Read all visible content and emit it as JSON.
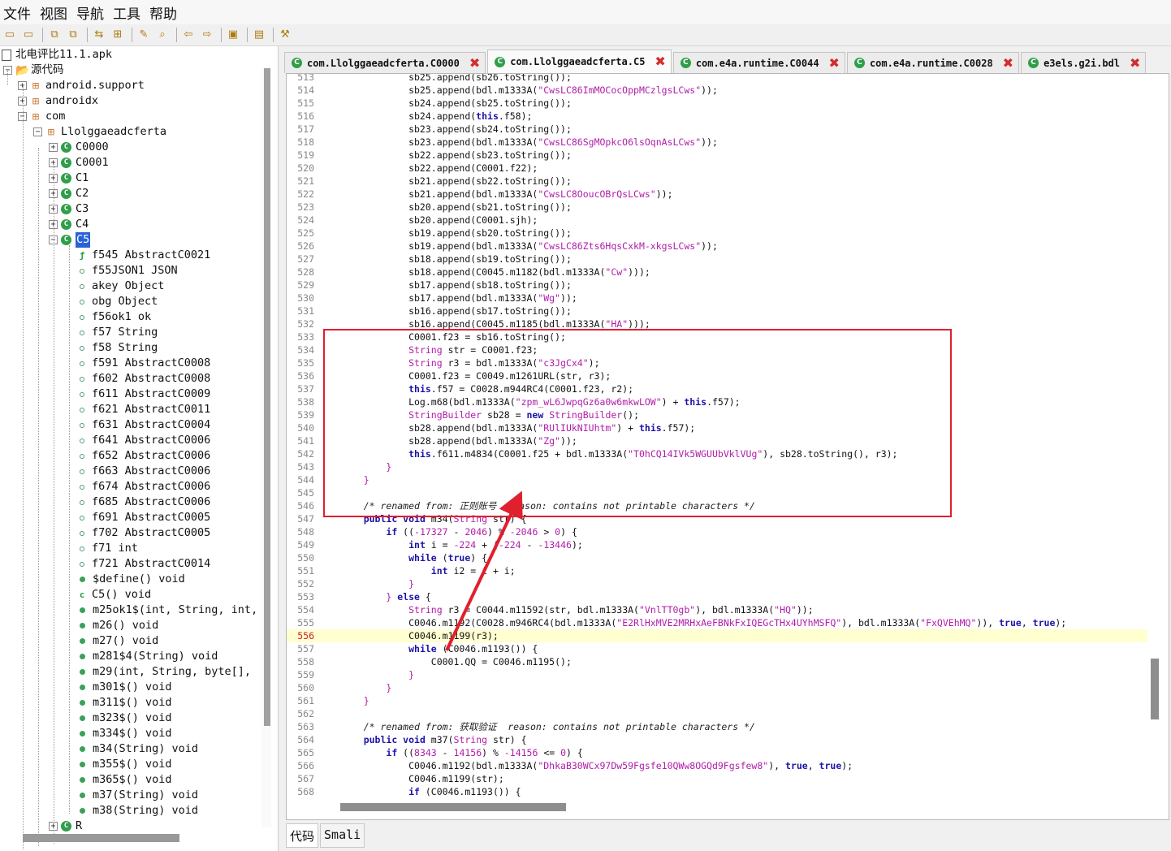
{
  "menu": [
    "文件",
    "视图",
    "导航",
    "工具",
    "帮助"
  ],
  "toolbar_icons": [
    "open-file-icon",
    "add-file-icon",
    "copy-icon",
    "copy-all-icon",
    "sync-icon",
    "tree-icon",
    "wand-icon",
    "search-icon",
    "back-arrow-icon",
    "forward-arrow-icon",
    "decompile-icon",
    "log-icon",
    "preferences-icon"
  ],
  "tree": {
    "root": "北电评比11.1.apk",
    "source": "源代码",
    "packages": [
      "android.support",
      "androidx",
      "com"
    ],
    "subpackage": "Llolggaeadcferta",
    "classes": [
      "C0000",
      "C0001",
      "C1",
      "C2",
      "C3",
      "C4",
      "C5"
    ],
    "selected_class": "C5",
    "members": [
      {
        "kind": "field-static",
        "text": "f545 AbstractC0021"
      },
      {
        "kind": "field",
        "text": "f55JSON1 JSON"
      },
      {
        "kind": "field",
        "text": "akey Object"
      },
      {
        "kind": "field",
        "text": "obg Object"
      },
      {
        "kind": "field",
        "text": "f56ok1 ok"
      },
      {
        "kind": "field",
        "text": "f57 String"
      },
      {
        "kind": "field",
        "text": "f58 String"
      },
      {
        "kind": "field",
        "text": "f591 AbstractC0008"
      },
      {
        "kind": "field",
        "text": "f602 AbstractC0008"
      },
      {
        "kind": "field",
        "text": "f611 AbstractC0009"
      },
      {
        "kind": "field",
        "text": "f621 AbstractC0011"
      },
      {
        "kind": "field",
        "text": "f631 AbstractC0004"
      },
      {
        "kind": "field",
        "text": "f641 AbstractC0006"
      },
      {
        "kind": "field",
        "text": "f652 AbstractC0006"
      },
      {
        "kind": "field",
        "text": "f663 AbstractC0006"
      },
      {
        "kind": "field",
        "text": "f674 AbstractC0006"
      },
      {
        "kind": "field",
        "text": "f685 AbstractC0006"
      },
      {
        "kind": "field",
        "text": "f691 AbstractC0005"
      },
      {
        "kind": "field",
        "text": "f702 AbstractC0005"
      },
      {
        "kind": "field",
        "text": "f71 int"
      },
      {
        "kind": "field",
        "text": "f721 AbstractC0014"
      },
      {
        "kind": "method",
        "text": "$define() void"
      },
      {
        "kind": "ctor",
        "text": "C5() void"
      },
      {
        "kind": "method",
        "text": "m25ok1$(int, String, int,"
      },
      {
        "kind": "method",
        "text": "m26() void"
      },
      {
        "kind": "method",
        "text": "m27() void"
      },
      {
        "kind": "method",
        "text": "m281$4(String) void"
      },
      {
        "kind": "method",
        "text": "m29(int, String, byte[],"
      },
      {
        "kind": "method",
        "text": "m301$() void"
      },
      {
        "kind": "method",
        "text": "m311$() void"
      },
      {
        "kind": "method",
        "text": "m323$() void"
      },
      {
        "kind": "method",
        "text": "m334$() void"
      },
      {
        "kind": "method",
        "text": "m34(String) void"
      },
      {
        "kind": "method",
        "text": "m355$() void"
      },
      {
        "kind": "method",
        "text": "m365$() void"
      },
      {
        "kind": "method",
        "text": "m37(String) void"
      },
      {
        "kind": "method",
        "text": "m38(String) void"
      }
    ],
    "last_row": "R"
  },
  "tabs": [
    {
      "label": "com.Llolggaeadcferta.C0000",
      "active": false
    },
    {
      "label": "com.Llolggaeadcferta.C5",
      "active": true
    },
    {
      "label": "com.e4a.runtime.C0044",
      "active": false
    },
    {
      "label": "com.e4a.runtime.C0028",
      "active": false
    },
    {
      "label": "e3els.g2i.bdl",
      "active": false
    }
  ],
  "current_line": "556",
  "code_lines": [
    {
      "n": "513",
      "html": "            sb25.append(sb26.toString());"
    },
    {
      "n": "514",
      "html": "            sb25.append(bdl.m1333A(<s>\"CwsLC86ImMOCocOppMCzlgsLCws\"</s>));"
    },
    {
      "n": "515",
      "html": "            sb24.append(sb25.toString());"
    },
    {
      "n": "516",
      "html": "            sb24.append(<k>this</k>.f58);"
    },
    {
      "n": "517",
      "html": "            sb23.append(sb24.toString());"
    },
    {
      "n": "518",
      "html": "            sb23.append(bdl.m1333A(<s>\"CwsLC86SgMOpkcO6lsOqnAsLCws\"</s>));"
    },
    {
      "n": "519",
      "html": "            sb22.append(sb23.toString());"
    },
    {
      "n": "520",
      "html": "            sb22.append(C0001.f22);"
    },
    {
      "n": "521",
      "html": "            sb21.append(sb22.toString());"
    },
    {
      "n": "522",
      "html": "            sb21.append(bdl.m1333A(<s>\"CwsLC8OoucOBrQsLCws\"</s>));"
    },
    {
      "n": "523",
      "html": "            sb20.append(sb21.toString());"
    },
    {
      "n": "524",
      "html": "            sb20.append(C0001.sjh);"
    },
    {
      "n": "525",
      "html": "            sb19.append(sb20.toString());"
    },
    {
      "n": "526",
      "html": "            sb19.append(bdl.m1333A(<s>\"CwsLC86Zts6HqsCxkM-xkgsLCws\"</s>));"
    },
    {
      "n": "527",
      "html": "            sb18.append(sb19.toString());"
    },
    {
      "n": "528",
      "html": "            sb18.append(C0045.m1182(bdl.m1333A(<s>\"Cw\"</s>)));"
    },
    {
      "n": "529",
      "html": "            sb17.append(sb18.toString());"
    },
    {
      "n": "530",
      "html": "            sb17.append(bdl.m1333A(<s>\"Wg\"</s>));"
    },
    {
      "n": "531",
      "html": "            sb16.append(sb17.toString());"
    },
    {
      "n": "532",
      "html": "            sb16.append(C0045.m1185(bdl.m1333A(<s>\"HA\"</s>)));"
    },
    {
      "n": "533",
      "html": "            C0001.f23 = sb16.toString();"
    },
    {
      "n": "534",
      "html": "            <t>String</t> str = C0001.f23;"
    },
    {
      "n": "535",
      "html": "            <t>String</t> r3 = bdl.m1333A(<s>\"c3JgCx4\"</s>);"
    },
    {
      "n": "536",
      "html": "            C0001.f23 = C0049.m1261URL(str, r3);"
    },
    {
      "n": "537",
      "html": "            <k>this</k>.f57 = C0028.m944RC4(C0001.f23, r2);"
    },
    {
      "n": "538",
      "html": "            Log.m68(bdl.m1333A(<s>\"zpm_wL6JwpqGz6a0w6mkwLOW\"</s>) + <k>this</k>.f57);"
    },
    {
      "n": "539",
      "html": "            <t>StringBuilder</t> sb28 = <k>new</k> <t>StringBuilder</t>();"
    },
    {
      "n": "540",
      "html": "            sb28.append(bdl.m1333A(<s>\"RUlIUkNIUhtm\"</s>) + <k>this</k>.f57);"
    },
    {
      "n": "541",
      "html": "            sb28.append(bdl.m1333A(<s>\"Zg\"</s>));"
    },
    {
      "n": "542",
      "html": "            <k>this</k>.f611.m4834(C0001.f25 + bdl.m1333A(<s>\"T0hCQ14IVk5WGUUbVklVUg\"</s>), sb28.toString(), r3);"
    },
    {
      "n": "543",
      "html": "        <s>}</s>"
    },
    {
      "n": "544",
      "html": "    <s>}</s>"
    },
    {
      "n": "545",
      "html": ""
    },
    {
      "n": "546",
      "html": "    <c>/* renamed from: 正则账号  reason: contains not printable characters */</c>"
    },
    {
      "n": "547",
      "html": "    <k>public void</k> m34(<t>String</t> str) {"
    },
    {
      "n": "548",
      "html": "        <k>if</k> ((<s>-17327</s> - <s>2046</s>) % <s>-2046</s> > <s>0</s>) {"
    },
    {
      "n": "549",
      "html": "            <k>int</k> i = <s>-224</s> + (<s>-224</s> - <s>-13446</s>);"
    },
    {
      "n": "550",
      "html": "            <k>while</k> (<k>true</k>) {"
    },
    {
      "n": "551",
      "html": "                <k>int</k> i2 = i + i;"
    },
    {
      "n": "552",
      "html": "            <s>}</s>"
    },
    {
      "n": "553",
      "html": "        <s>}</s> <k>else</k> {"
    },
    {
      "n": "554",
      "html": "            <t>String</t> r3 = C0044.m11592(str, bdl.m1333A(<s>\"VnlTT0gb\"</s>), bdl.m1333A(<s>\"HQ\"</s>));"
    },
    {
      "n": "555",
      "html": "            C0046.m1192(C0028.m946RC4(bdl.m1333A(<s>\"E2RlHxMVE2MRHxAeFBNkFxIQEGcTHx4UYhMSFQ\"</s>), bdl.m1333A(<s>\"FxQVEhMQ\"</s>)), <k>true</k>, <k>true</k>);"
    },
    {
      "n": "556",
      "html": "            C0046.m1199(r3);"
    },
    {
      "n": "557",
      "html": "            <k>while</k> (C0046.m1193()) {"
    },
    {
      "n": "558",
      "html": "                C0001.QQ = C0046.m1195();"
    },
    {
      "n": "559",
      "html": "            <s>}</s>"
    },
    {
      "n": "560",
      "html": "        <s>}</s>"
    },
    {
      "n": "561",
      "html": "    <s>}</s>"
    },
    {
      "n": "562",
      "html": ""
    },
    {
      "n": "563",
      "html": "    <c>/* renamed from: 获取验证  reason: contains not printable characters */</c>"
    },
    {
      "n": "564",
      "html": "    <k>public void</k> m37(<t>String</t> str) {"
    },
    {
      "n": "565",
      "html": "        <k>if</k> ((<s>8343</s> - <s>14156</s>) % <s>-14156</s> <= <s>0</s>) {"
    },
    {
      "n": "566",
      "html": "            C0046.m1192(bdl.m1333A(<s>\"DhkaB30WCx97Dw59Fgsfe10QWw8OGQd9Fgsfew8\"</s>), <k>true</k>, <k>true</k>);"
    },
    {
      "n": "567",
      "html": "            C0046.m1199(str);"
    },
    {
      "n": "568",
      "html": "            <k>if</k> (C0046.m1193()) {"
    }
  ],
  "bottom_tabs": [
    "代码",
    "Smali"
  ],
  "colors": {
    "highlight_box": "#e01f2f",
    "arrow": "#e01f2f",
    "keyword": "#1c14a8",
    "string": "#b01da8"
  }
}
